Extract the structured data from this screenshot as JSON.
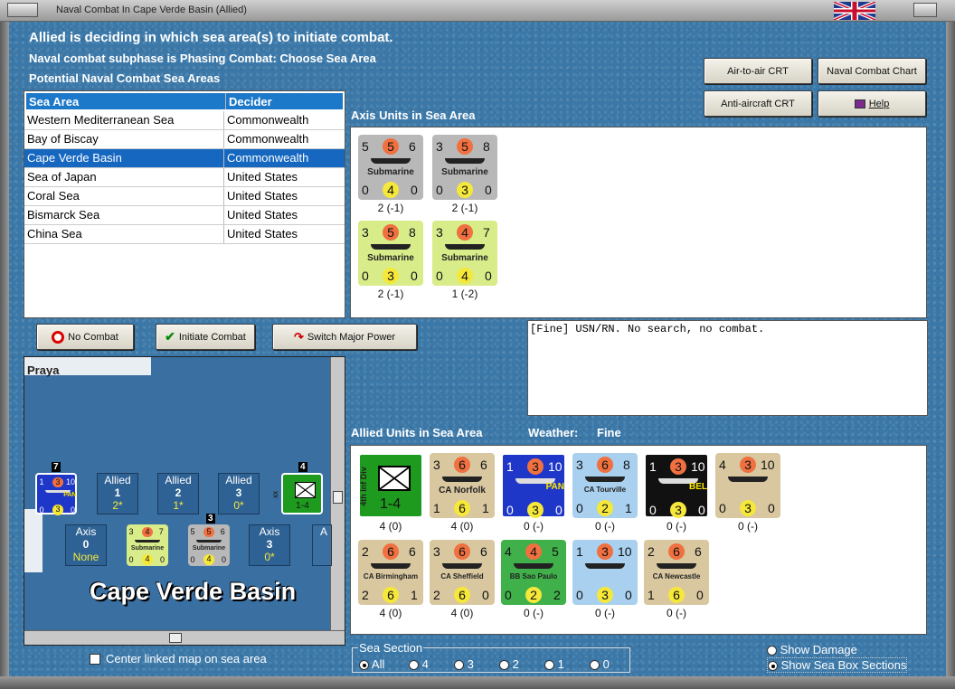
{
  "window": {
    "title": "Naval Combat In Cape Verde Basin (Allied)"
  },
  "header": {
    "line1": "Allied is deciding in which sea area(s) to initiate combat.",
    "line2": "Naval combat subphase is Phasing Combat: Choose Sea Area",
    "line3": "Potential Naval Combat Sea Areas"
  },
  "buttons": {
    "air_to_air": "Air-to-air CRT",
    "naval_chart": "Naval Combat Chart",
    "anti_aircraft": "Anti-aircraft CRT",
    "help": "Help",
    "no_combat": "No Combat",
    "initiate": "Initiate Combat",
    "switch_power": "Switch Major Power"
  },
  "sea_table": {
    "col1": "Sea Area",
    "col2": "Decider",
    "rows": [
      {
        "area": "Western Mediterranean Sea",
        "decider": "Commonwealth"
      },
      {
        "area": "Bay of Biscay",
        "decider": "Commonwealth"
      },
      {
        "area": "Cape Verde Basin",
        "decider": "Commonwealth"
      },
      {
        "area": "Sea of Japan",
        "decider": "United States"
      },
      {
        "area": "Coral Sea",
        "decider": "United States"
      },
      {
        "area": "Bismarck Sea",
        "decider": "United States"
      },
      {
        "area": "China Sea",
        "decider": "United States"
      }
    ]
  },
  "axis": {
    "label": "Axis Units in Sea Area",
    "units": [
      {
        "tl": "5",
        "tc": "5",
        "tr": "6",
        "name": "Submarine",
        "bl": "0",
        "bc": "4",
        "br": "0",
        "caption": "2 (-1)",
        "color": "#b8b8b8"
      },
      {
        "tl": "3",
        "tc": "5",
        "tr": "8",
        "name": "Submarine",
        "bl": "0",
        "bc": "3",
        "br": "0",
        "caption": "2 (-1)",
        "color": "#b8b8b8"
      },
      {
        "tl": "3",
        "tc": "5",
        "tr": "8",
        "name": "Submarine",
        "bl": "0",
        "bc": "3",
        "br": "0",
        "caption": "2 (-1)",
        "color": "#d8ec8a"
      },
      {
        "tl": "3",
        "tc": "4",
        "tr": "7",
        "name": "Submarine",
        "bl": "0",
        "bc": "4",
        "br": "0",
        "caption": "1 (-2)",
        "color": "#d8ec8a"
      }
    ]
  },
  "message": "[Fine]  USN/RN.  No search, no combat.",
  "allied": {
    "label": "Allied Units in Sea Area",
    "weather_label": "Weather:",
    "weather": "Fine",
    "units": [
      {
        "tl": "",
        "tc": "",
        "tr": "",
        "name": "4th Inf Div",
        "bl": "",
        "bc": "1-4",
        "br": "",
        "caption": "4 (0)",
        "color": "#1e9a1e"
      },
      {
        "tl": "3",
        "tc": "6",
        "tr": "6",
        "name": "CA Norfolk",
        "bl": "1",
        "bc": "6",
        "br": "1",
        "caption": "4 (0)",
        "color": "#d9c7a0"
      },
      {
        "tl": "1",
        "tc": "3",
        "tr": "10",
        "name": "PAN",
        "bl": "0",
        "bc": "3",
        "br": "0",
        "caption": "0 (-)",
        "color": "#1f37c8"
      },
      {
        "tl": "3",
        "tc": "6",
        "tr": "8",
        "name": "CA Tourville",
        "bl": "0",
        "bc": "2",
        "br": "1",
        "caption": "0 (-)",
        "color": "#a9d0ee"
      },
      {
        "tl": "1",
        "tc": "3",
        "tr": "10",
        "name": "BEL",
        "bl": "0",
        "bc": "3",
        "br": "0",
        "caption": "0 (-)",
        "color": "#111111"
      },
      {
        "tl": "4",
        "tc": "3",
        "tr": "10",
        "name": "",
        "bl": "0",
        "bc": "3",
        "br": "0",
        "caption": "0 (-)",
        "color": "#d9c7a0"
      },
      {
        "tl": "2",
        "tc": "6",
        "tr": "6",
        "name": "CA Birmingham",
        "bl": "2",
        "bc": "6",
        "br": "1",
        "caption": "4 (0)",
        "color": "#d9c7a0"
      },
      {
        "tl": "3",
        "tc": "6",
        "tr": "6",
        "name": "CA Sheffield",
        "bl": "2",
        "bc": "6",
        "br": "0",
        "caption": "4 (0)",
        "color": "#d9c7a0"
      },
      {
        "tl": "4",
        "tc": "4",
        "tr": "5",
        "name": "BB Sao Paulo",
        "bl": "0",
        "bc": "2",
        "br": "2",
        "caption": "0 (-)",
        "color": "#3fb04a"
      },
      {
        "tl": "1",
        "tc": "3",
        "tr": "10",
        "name": "",
        "bl": "0",
        "bc": "3",
        "br": "0",
        "caption": "0 (-)",
        "color": "#a9d0ee"
      },
      {
        "tl": "2",
        "tc": "6",
        "tr": "6",
        "name": "CA Newcastle",
        "bl": "1",
        "bc": "6",
        "br": "0",
        "caption": "0 (-)",
        "color": "#d9c7a0"
      }
    ]
  },
  "map": {
    "praya": "Praya",
    "sea_name": "Cape Verde Basin",
    "allied_boxes": [
      {
        "label": "Allied",
        "num": "1",
        "val": "2*"
      },
      {
        "label": "Allied",
        "num": "2",
        "val": "1*"
      },
      {
        "label": "Allied",
        "num": "3",
        "val": "0*"
      }
    ],
    "axis_boxes": [
      {
        "label": "Axis",
        "num": "0",
        "val": "None"
      },
      {
        "label": "Axis",
        "num": "3",
        "val": "0*"
      }
    ],
    "axis_box_partial": "A",
    "stack_nums": [
      "7",
      "4",
      "3"
    ],
    "mini_units": [
      {
        "tl": "1",
        "tc": "3",
        "tr": "10",
        "name": "PAN",
        "bl": "0",
        "bc": "3",
        "br": "0"
      },
      {
        "tl": "",
        "tc": "",
        "tr": "",
        "name": "XX",
        "bl": "",
        "bc": "1-4",
        "br": ""
      },
      {
        "tl": "3",
        "tc": "4",
        "tr": "7",
        "name": "Submarine",
        "bl": "0",
        "bc": "4",
        "br": "0"
      },
      {
        "tl": "5",
        "tc": "5",
        "tr": "6",
        "name": "Submarine",
        "bl": "0",
        "bc": "4",
        "br": "0"
      }
    ]
  },
  "center_map_label": "Center linked map on sea area",
  "sea_section": {
    "legend": "Sea Section",
    "options": [
      "All",
      "4",
      "3",
      "2",
      "1",
      "0"
    ],
    "selected": "All"
  },
  "view_options": {
    "damage": "Show Damage",
    "sections": "Show Sea Box Sections",
    "selected": "Show Sea Box Sections"
  }
}
